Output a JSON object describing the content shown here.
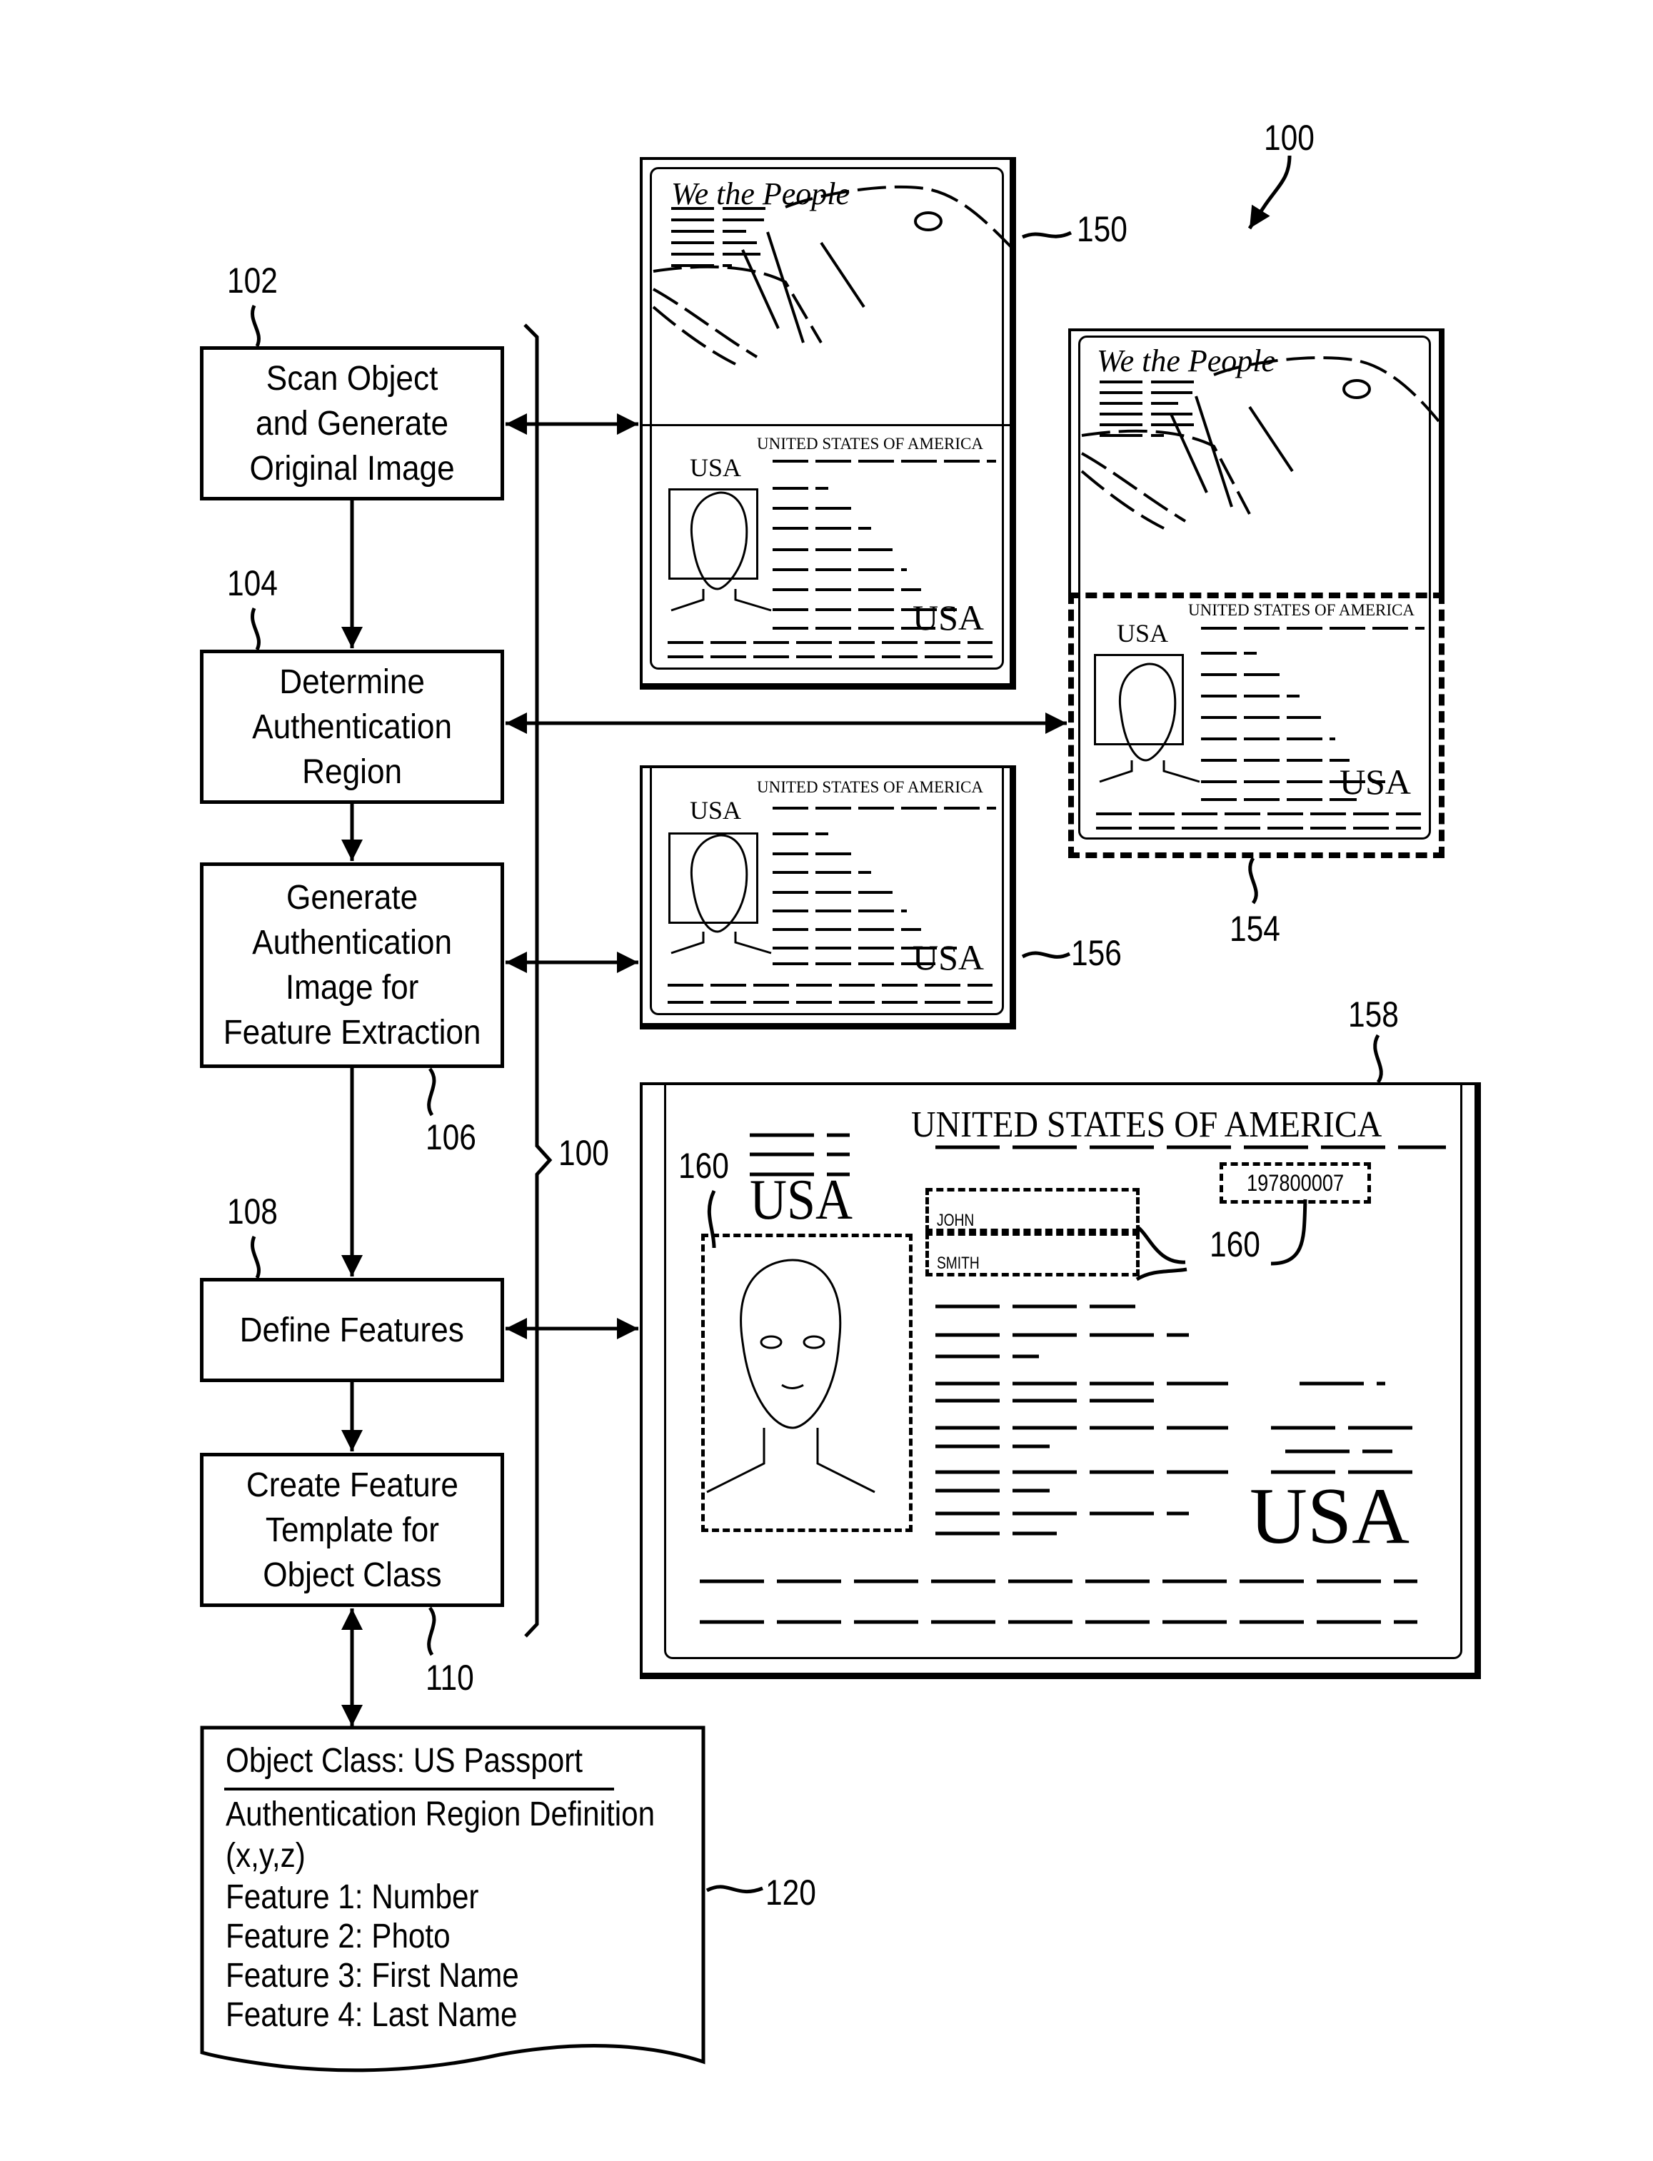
{
  "figure": {
    "ref_main": "100",
    "ref_bracket": "100"
  },
  "flow_steps": [
    {
      "ref": "102",
      "label": "Scan Object\nand Generate\nOriginal Image"
    },
    {
      "ref": "104",
      "label": "Determine\nAuthentication\nRegion"
    },
    {
      "ref": "106",
      "label": "Generate\nAuthentication\nImage for\nFeature Extraction"
    },
    {
      "ref": "108",
      "label": "Define Features"
    },
    {
      "ref": "110",
      "label": "Create Feature\nTemplate for\nObject Class"
    }
  ],
  "template_doc": {
    "ref": "120",
    "title": "Object Class: US Passport",
    "lines": [
      "Authentication Region Definition",
      "(x,y,z)",
      "Feature 1: Number",
      "Feature 2: Photo",
      "Feature 3: First Name",
      "Feature 4: Last Name"
    ]
  },
  "passports": {
    "original": {
      "ref": "150",
      "motto": "We the People",
      "country": "UNITED STATES OF AMERICA",
      "code_small": "USA",
      "code_large": "USA"
    },
    "region": {
      "ref": "154",
      "motto": "We the People",
      "country": "UNITED STATES OF AMERICA",
      "code_small": "USA",
      "code_large": "USA"
    },
    "auth_image": {
      "ref": "156",
      "country": "UNITED STATES OF AMERICA",
      "code_small": "USA",
      "code_large": "USA"
    },
    "features": {
      "ref": "158",
      "feature_ref_photo": "160",
      "feature_ref_fields": "160",
      "country": "UNITED STATES OF AMERICA",
      "code_small": "USA",
      "code_large": "USA",
      "first_name": "JOHN",
      "last_name": "SMITH",
      "number": "197800007"
    }
  }
}
